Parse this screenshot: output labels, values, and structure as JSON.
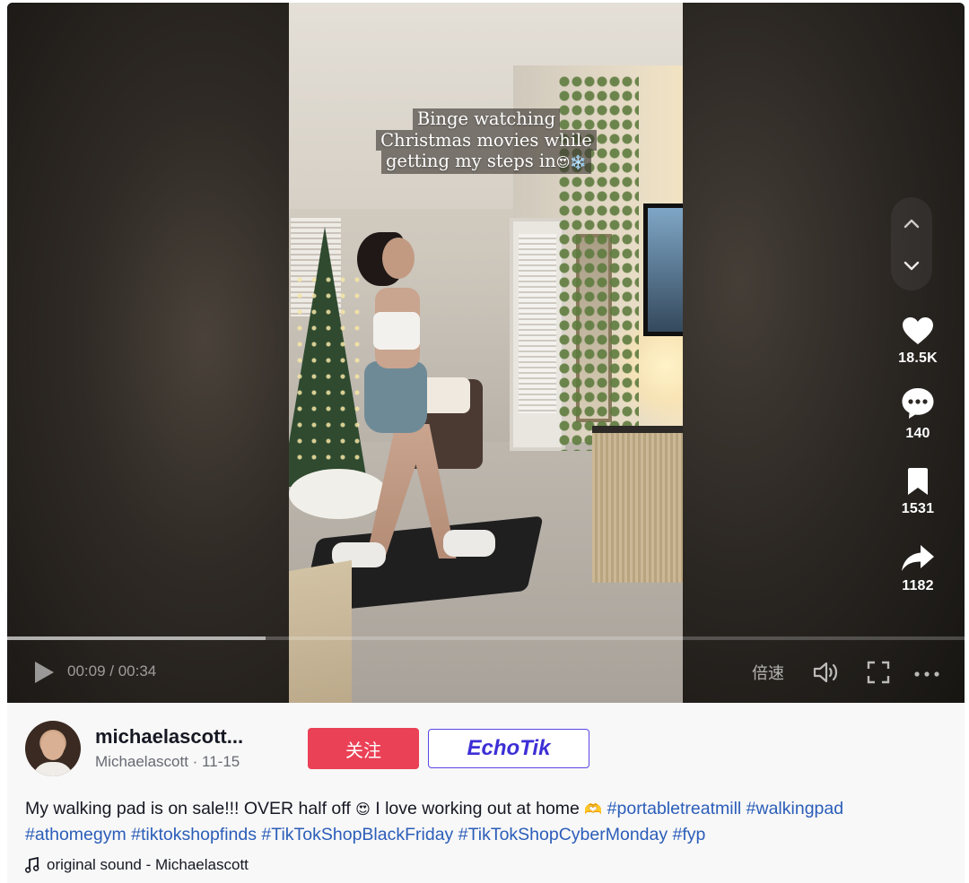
{
  "video": {
    "caption_lines": [
      "Binge watching",
      "Christmas movies while",
      "getting my steps in"
    ],
    "caption_emoji": "😍❄️",
    "progress": 0.27,
    "current_time": "00:09",
    "duration": "00:34",
    "time_text": "00:09 / 00:34",
    "speed_label": "倍速"
  },
  "actions": {
    "likes": "18.5K",
    "comments": "140",
    "saves": "1531",
    "shares": "1182"
  },
  "icons": {
    "play": "play-icon",
    "volume": "volume-icon",
    "fullscreen": "fullscreen-icon",
    "more": "more-icon",
    "like": "heart-icon",
    "comment": "comment-icon",
    "save": "bookmark-icon",
    "share": "share-icon",
    "nav_up": "chevron-up-icon",
    "nav_down": "chevron-down-icon",
    "music": "music-note-icon"
  },
  "author": {
    "name": "michaelascott...",
    "display_name": "Michaelascott",
    "date": "11-15",
    "sub_text": "Michaelascott · 11-15"
  },
  "buttons": {
    "follow": "关注",
    "echotik": "EchoTik"
  },
  "description": {
    "text": "My walking pad is on sale!!! OVER half off ",
    "emoji_1": "😍",
    "text_2": " I love working out at home ",
    "emoji_2": "🫶",
    "hashtags_line1": [
      "#portabletreatmill",
      "#walkingpad"
    ],
    "hashtags_line2": [
      "#athomegym",
      "#tiktokshopfinds",
      "#TikTokShopBlackFriday",
      "#TikTokShopCyberMonday",
      "#fyp"
    ]
  },
  "music": {
    "label": "original sound - Michaelascott"
  },
  "colors": {
    "follow_bg": "#ea4156",
    "hashtag": "#2b5db9",
    "echotik_accent": "#3d2fd6"
  }
}
